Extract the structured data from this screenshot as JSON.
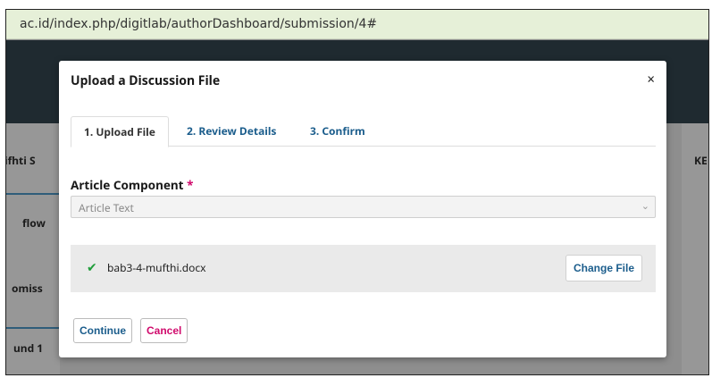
{
  "browser": {
    "url": "ac.id/index.php/digitlab/authorDashboard/submission/4#"
  },
  "background": {
    "labels": [
      "ifhti S",
      "flow",
      "omiss",
      "und 1",
      "KE"
    ]
  },
  "modal": {
    "title": "Upload a Discussion File",
    "close_label": "×",
    "tabs": [
      {
        "label": "1. Upload File"
      },
      {
        "label": "2. Review Details"
      },
      {
        "label": "3. Confirm"
      }
    ],
    "field": {
      "label": "Article Component",
      "required_mark": "*",
      "selected_value": "Article Text",
      "chevron": "⌄"
    },
    "file": {
      "check_glyph": "✔",
      "name": "bab3-4-mufthi.docx",
      "change_label": "Change File"
    },
    "actions": {
      "continue_label": "Continue",
      "cancel_label": "Cancel"
    }
  },
  "colors": {
    "link_blue": "#1b5d8c",
    "required_pink": "#d00a6c",
    "check_green": "#1f9d3a"
  }
}
